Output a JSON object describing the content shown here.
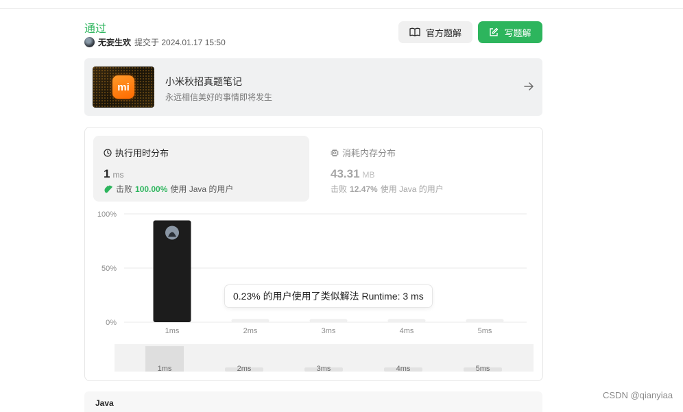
{
  "header": {
    "status": "通过",
    "username": "无妄生欢",
    "submitted_text": "提交于 2024.01.17 15:50"
  },
  "buttons": {
    "official_solution": "官方题解",
    "write_solution": "写题解"
  },
  "note_card": {
    "logo_text": "mi",
    "title": "小米秋招真题笔记",
    "subtitle": "永远相信美好的事情即将发生"
  },
  "runtime": {
    "title": "执行用时分布",
    "value": "1",
    "unit": "ms",
    "beats_label": "击败",
    "beats_pct": "100.00%",
    "beats_suffix": "使用 Java 的用户"
  },
  "memory": {
    "title": "消耗内存分布",
    "value": "43.31",
    "unit": "MB",
    "beats_label": "击败",
    "beats_pct": "12.47%",
    "beats_suffix": "使用 Java 的用户"
  },
  "chart_data": {
    "type": "bar",
    "categories": [
      "1ms",
      "2ms",
      "3ms",
      "4ms",
      "5ms"
    ],
    "values": [
      94,
      3,
      3,
      3,
      3
    ],
    "ylim": [
      0,
      100
    ],
    "y_ticks": [
      "0%",
      "50%",
      "100%"
    ],
    "highlight_index": 0,
    "grid": true,
    "colors": {
      "highlight": "#1c1c1c",
      "bar": "#f0f0f0",
      "grid": "#e8e8e8"
    }
  },
  "tooltip": "0.23% 的用户使用了类似解法 Runtime: 3 ms",
  "overview": {
    "categories": [
      "1ms",
      "2ms",
      "3ms",
      "4ms",
      "5ms"
    ],
    "selected_index": 0
  },
  "language": "Java",
  "watermark": "CSDN @qianyiaa",
  "colors": {
    "accent": "#2db55d",
    "text": "#262626",
    "muted": "#8c8c8c"
  }
}
